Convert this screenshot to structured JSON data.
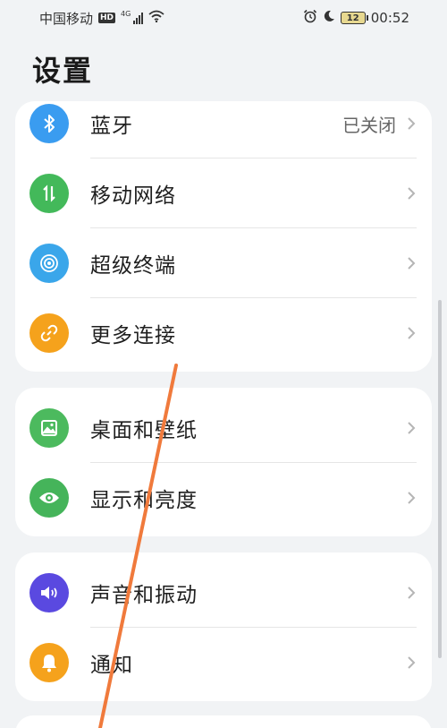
{
  "status_bar": {
    "carrier": "中国移动",
    "hd": "HD",
    "network": "4G",
    "battery": "12",
    "time": "00:52"
  },
  "page": {
    "title": "设置"
  },
  "sections": [
    {
      "items": [
        {
          "label": "蓝牙",
          "value": "已关闭",
          "icon": "bluetooth-icon",
          "color": "#3a9cf0"
        },
        {
          "label": "移动网络",
          "icon": "mobile-data-icon",
          "color": "#43b95a"
        },
        {
          "label": "超级终端",
          "icon": "super-device-icon",
          "color": "#3aa6ea"
        },
        {
          "label": "更多连接",
          "icon": "link-icon",
          "color": "#f5a21c"
        }
      ]
    },
    {
      "items": [
        {
          "label": "桌面和壁纸",
          "icon": "wallpaper-icon",
          "color": "#4cba5e"
        },
        {
          "label": "显示和亮度",
          "icon": "eye-icon",
          "color": "#45b45a"
        }
      ]
    },
    {
      "items": [
        {
          "label": "声音和振动",
          "icon": "sound-icon",
          "color": "#5a49e0"
        },
        {
          "label": "通知",
          "icon": "bell-icon",
          "color": "#f5a21c"
        }
      ]
    }
  ],
  "colors": {
    "background": "#f1f3f5",
    "card": "#ffffff",
    "annotation_stroke": "#f07a3c"
  }
}
